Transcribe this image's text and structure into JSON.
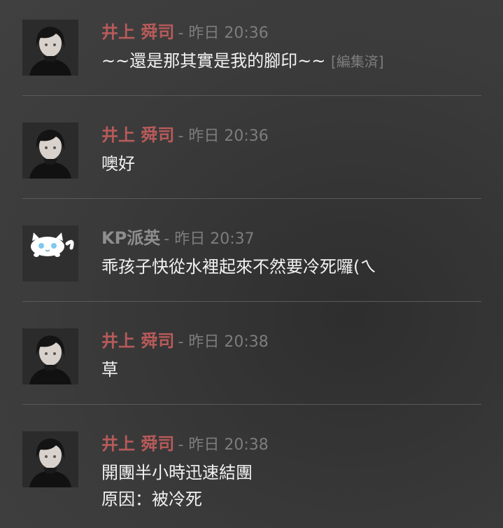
{
  "messages": [
    {
      "author": "井上 舜司",
      "author_color": "#b85a5a",
      "avatar": "dark-hair-character-avatar",
      "timestamp": "- 昨日 20:36",
      "lines": [
        "~~還是那其實是我的腳印~~"
      ],
      "edited_label": "[編集済]"
    },
    {
      "author": "井上 舜司",
      "author_color": "#b85a5a",
      "avatar": "dark-hair-character-avatar",
      "timestamp": "- 昨日 20:36",
      "lines": [
        "噢好"
      ]
    },
    {
      "author": "KP派英",
      "author_color": "#8e8e8e",
      "avatar": "white-cat-avatar",
      "timestamp": "- 昨日 20:37",
      "lines": [
        "乖孩子快從水裡起來不然要冷死囉(ㄟ"
      ]
    },
    {
      "author": "井上 舜司",
      "author_color": "#b85a5a",
      "avatar": "dark-hair-character-avatar",
      "timestamp": "- 昨日 20:38",
      "lines": [
        "草"
      ]
    },
    {
      "author": "井上 舜司",
      "author_color": "#b85a5a",
      "avatar": "dark-hair-character-avatar",
      "timestamp": "- 昨日 20:38",
      "lines": [
        "開團半小時迅速結團",
        "原因：被冷死"
      ]
    }
  ]
}
